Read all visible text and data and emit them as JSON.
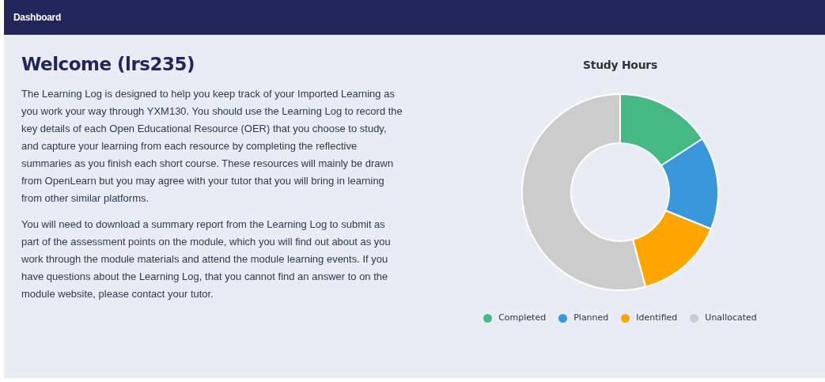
{
  "navbar": {
    "title": "Dashboard"
  },
  "welcome": {
    "heading": "Welcome (lrs235)",
    "paragraphs": [
      "The Learning Log is designed to help you keep track of your Imported Learning as you work your way through YXM130. You should use the Learning Log to record the key details of each Open Educational Resource (OER) that you choose to study, and capture your learning from each resource by completing the reflective summaries as you finish each short course. These resources will mainly be drawn from OpenLearn but you may agree with your tutor that you will bring in learning from other similar platforms.",
      "You will need to download a summary report from the Learning Log to submit as part of the assessment points on the module, which you will find out about as you work through the module materials and attend the module learning events. If you have questions about the Learning Log, that you cannot find an answer to on the module website, please contact your tutor."
    ]
  },
  "study_hours": {
    "title": "Study Hours",
    "legend": [
      {
        "label": "Completed",
        "color": "#44b984"
      },
      {
        "label": "Planned",
        "color": "#3898da"
      },
      {
        "label": "Identified",
        "color": "#fea500"
      },
      {
        "label": "Unallocated",
        "color": "#cccccc"
      }
    ]
  }
}
